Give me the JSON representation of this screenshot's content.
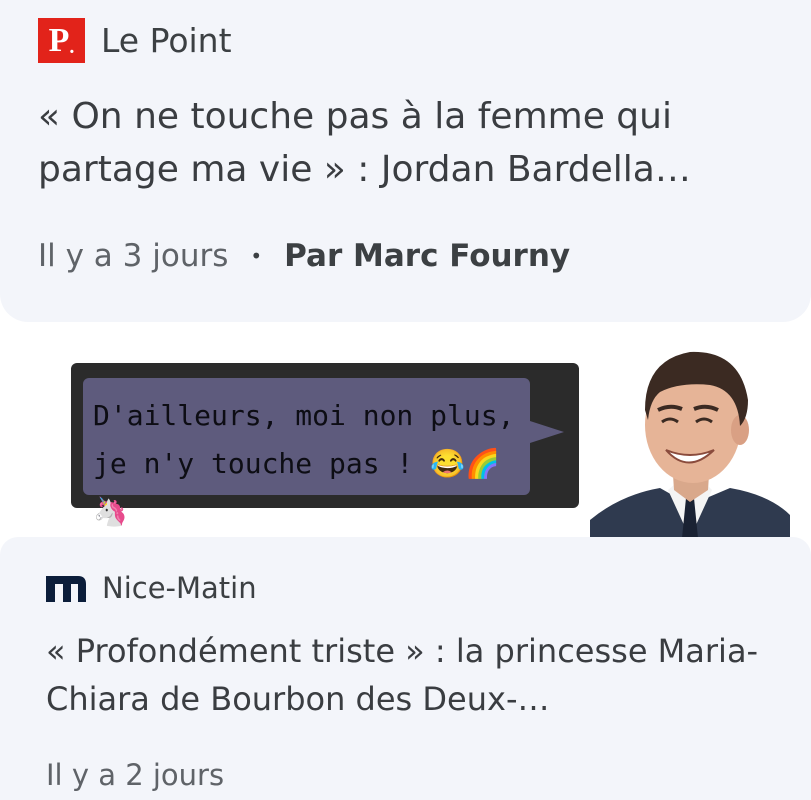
{
  "article1": {
    "source": "Le Point",
    "logo_text": "P",
    "logo_color": "#e2231a",
    "headline": "« On ne touche pas à la femme qui partage ma vie » : Jordan Bardella…",
    "time": "Il y a 3 jours",
    "author": "Par Marc Fourny"
  },
  "reply": {
    "text": "D'ailleurs, moi non plus, je n'y touche pas ! 😂🌈🦄",
    "bubble_color": "#5e5b7d",
    "box_color": "#2b2b2b"
  },
  "photo": {
    "icon": "person-photo"
  },
  "article2": {
    "source": "Nice-Matin",
    "logo_color": "#0b1d3a",
    "headline": "« Profondément triste » : la princesse Maria-Chiara de Bourbon des Deux-…",
    "time": "Il y a 2 jours"
  }
}
